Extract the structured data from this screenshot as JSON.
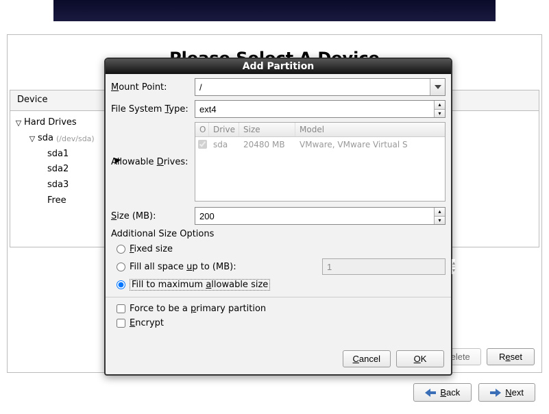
{
  "page_title": "Please Select A Device",
  "device_header": "Device",
  "tree": {
    "root": "Hard Drives",
    "disk": "sda",
    "disk_path": "(/dev/sda)",
    "parts": [
      "sda1",
      "sda2",
      "sda3",
      "Free"
    ]
  },
  "buttons": {
    "delete": "Delete",
    "reset": "Reset",
    "back": "Back",
    "next": "Next"
  },
  "dialog": {
    "title": "Add Partition",
    "labels": {
      "mount_point": "Mount Point:",
      "mount_point_u": "M",
      "fs_type": "File System Type:",
      "fs_type_u": "T",
      "allowable_drives": "Allowable Drives:",
      "allowable_u": "D",
      "size": "Size (MB):",
      "size_u": "S",
      "additional": "Additional Size Options",
      "fixed": "Fixed size",
      "fixed_u": "F",
      "fill_up": "Fill all space up to (MB):",
      "fill_up_u": "u",
      "fill_max": "Fill to maximum allowable size",
      "fill_max_u": "a",
      "primary": "Force to be a primary partition",
      "primary_u": "p",
      "encrypt": "Encrypt",
      "encrypt_u": "E"
    },
    "values": {
      "mount_point": "/",
      "fs_type": "ext4",
      "size": "200",
      "fill_up_value": "1"
    },
    "drives": {
      "headers": {
        "check": "O",
        "drive": "Drive",
        "size": "Size",
        "model": "Model"
      },
      "row": {
        "drive": "sda",
        "size": "20480 MB",
        "model": "VMware, VMware Virtual S"
      }
    },
    "footer": {
      "cancel": "Cancel",
      "ok": "OK",
      "cancel_u": "C",
      "ok_u": "O"
    }
  }
}
